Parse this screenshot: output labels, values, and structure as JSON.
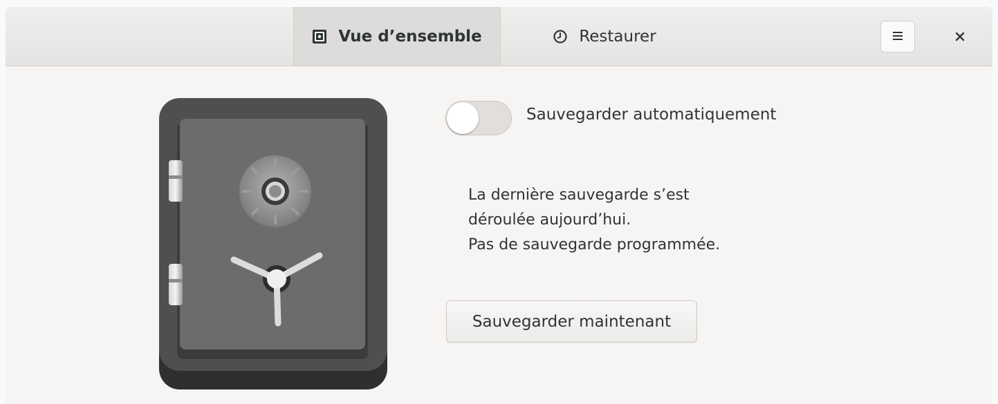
{
  "tabs": [
    {
      "label": "Vue d’ensemble",
      "icon": "safe-icon",
      "active": true
    },
    {
      "label": "Restaurer",
      "icon": "clock-icon",
      "active": false
    }
  ],
  "header": {
    "menu_icon": "hamburger-menu-icon",
    "close_icon": "close-icon"
  },
  "overview": {
    "auto_backup_label": "Sauvegarder automatiquement",
    "auto_backup_enabled": false,
    "status_lines": [
      "La dernière sauvegarde s’est",
      "déroulée aujourd’hui.",
      "Pas de sauvegarde programmée."
    ],
    "backup_now_label": "Sauvegarder maintenant",
    "illustration": "safe-illustration"
  },
  "colors": {
    "background": "#f6f5f4",
    "headerbar": "#e8e6e3",
    "active_tab": "#dedcda",
    "safe_body": "#4f4f52"
  }
}
